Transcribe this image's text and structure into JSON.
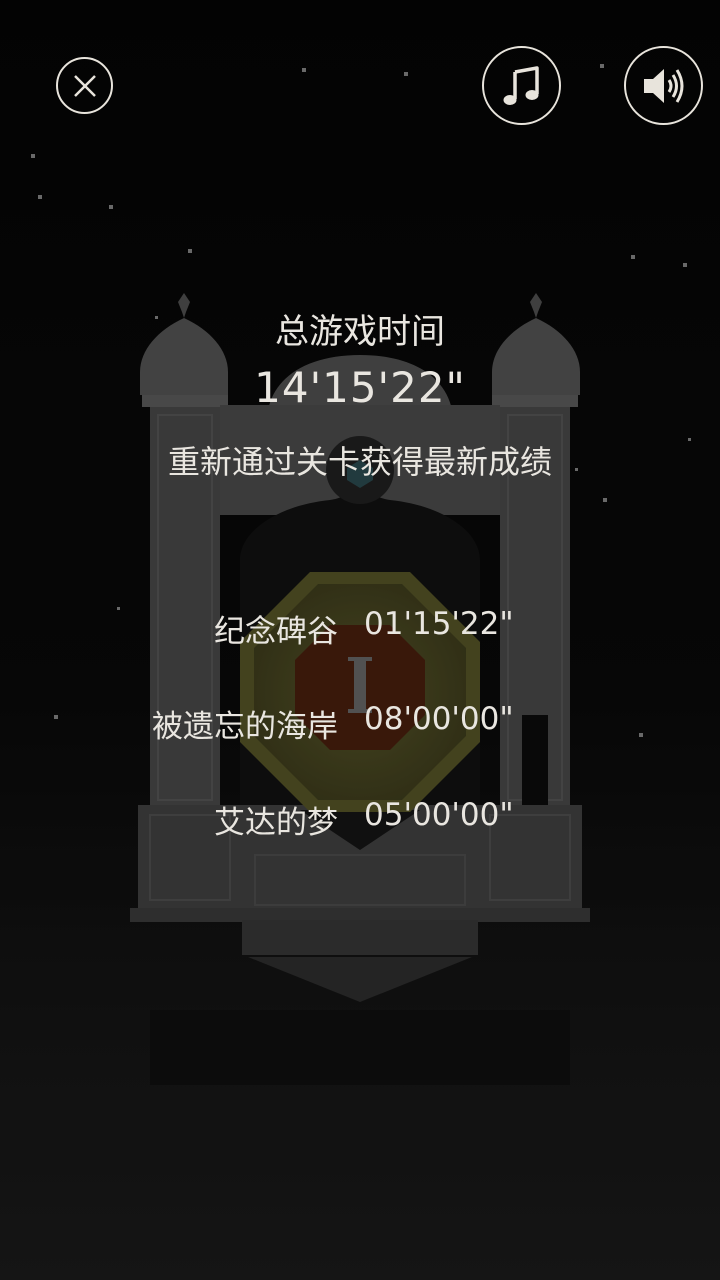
{
  "header": {
    "close_icon": "close-x-icon",
    "music_icon": "music-note-icon",
    "sound_icon": "speaker-volume-icon"
  },
  "summary": {
    "total_label": "总游戏时间",
    "total_time": "14'15'22\"",
    "hint": "重新通过关卡获得最新成绩"
  },
  "levels": [
    {
      "name": "纪念碑谷",
      "time": "01'15'22\""
    },
    {
      "name": "被遗忘的海岸",
      "time": "08'00'00\""
    },
    {
      "name": "艾达的梦",
      "time": "05'00'00\""
    }
  ],
  "colors": {
    "text": "#e9e6e0",
    "background": "#0b0b0b",
    "tower": "#4d4d4d",
    "octagon_outer": "#8a8435",
    "octagon_inner": "#7a2e10"
  }
}
